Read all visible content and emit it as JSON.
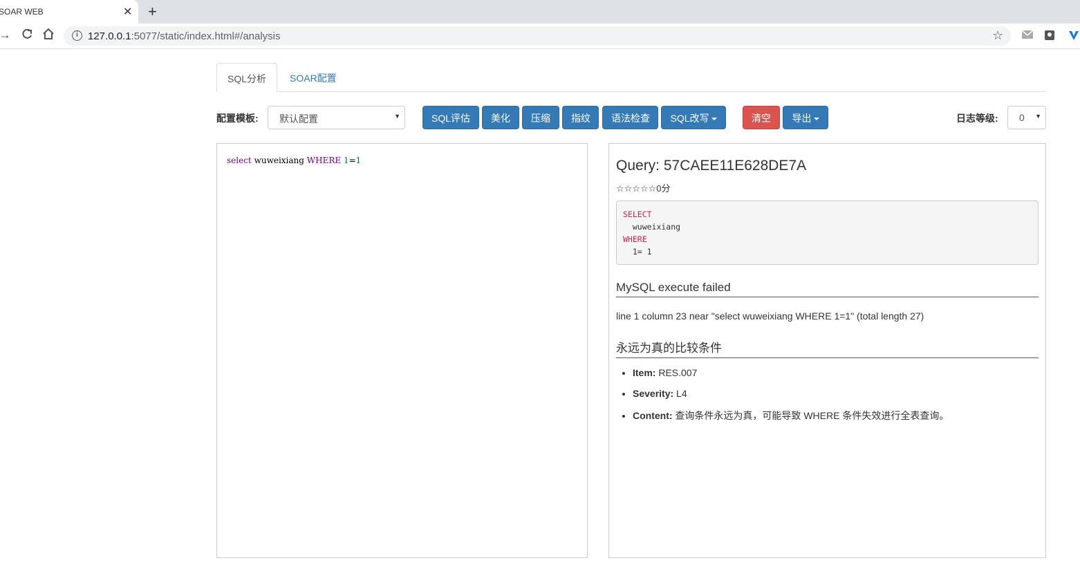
{
  "browser": {
    "tab_title": "SOAR WEB",
    "tab_close": "✕",
    "new_tab": "+",
    "url_host": "127.0.0.1",
    "url_rest": ":5077/static/index.html#/analysis"
  },
  "tabs": [
    {
      "label": "SQL分析"
    },
    {
      "label": "SOAR配置"
    }
  ],
  "toolbar": {
    "config_label": "配置模板:",
    "config_value": "默认配置",
    "buttons": {
      "evaluate": "SQL评估",
      "beautify": "美化",
      "compress": "压缩",
      "fingerprint": "指纹",
      "syntax_check": "语法检查",
      "rewrite": "SQL改写",
      "clear": "清空",
      "export": "导出"
    },
    "log_label": "日志等级:",
    "log_value": "0"
  },
  "editor": {
    "tokens": [
      "select",
      " wuweixiang ",
      "WHERE",
      " ",
      "1",
      "=",
      "1"
    ]
  },
  "result": {
    "query_title": "Query: 57CAEE11E628DE7A",
    "stars": "☆☆☆☆☆0分",
    "formatted_sql": {
      "l1": "SELECT",
      "l2": "  wuweixiang",
      "l3": "WHERE",
      "l4": "  1= 1"
    },
    "error_heading": "MySQL execute failed",
    "error_text": "line 1 column 23 near \"select wuweixiang WHERE 1=1\" (total length 27)",
    "rule_heading": "永远为真的比较条件",
    "items": [
      {
        "key": "Item:",
        "value": " RES.007"
      },
      {
        "key": "Severity:",
        "value": " L4"
      },
      {
        "key": "Content:",
        "value": " 查询条件永远为真，可能导致 WHERE 条件失效进行全表查询。"
      }
    ]
  }
}
